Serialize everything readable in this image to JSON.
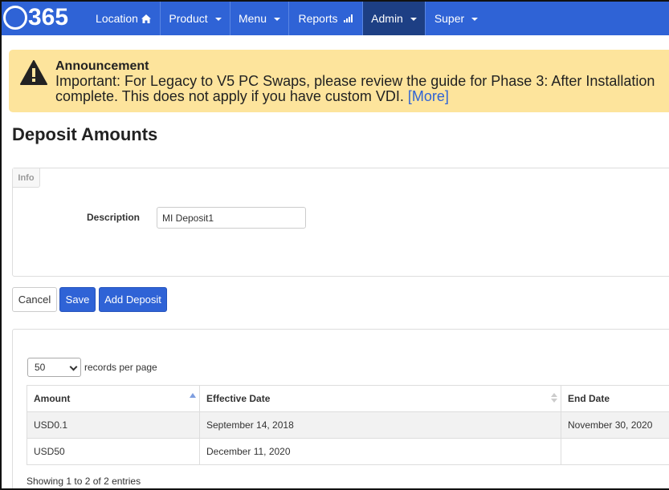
{
  "nav": {
    "logo_text": "365",
    "items": [
      {
        "label": "Location",
        "icon": "home-icon",
        "active": false,
        "caret": false
      },
      {
        "label": "Product",
        "active": false,
        "caret": true
      },
      {
        "label": "Menu",
        "active": false,
        "caret": true
      },
      {
        "label": "Reports",
        "icon": "signal-icon",
        "active": false,
        "caret": false
      },
      {
        "label": "Admin",
        "active": true,
        "caret": true
      },
      {
        "label": "Super",
        "active": false,
        "caret": true
      }
    ]
  },
  "announcement": {
    "title": "Announcement",
    "line1": "Important: For Legacy to V5 PC Swaps, please review the guide for Phase 3: After Installation",
    "line2": "complete. This does not apply if you have custom VDI.",
    "more_link": "[More]",
    "icon": "warning-icon",
    "background": "#fde49c"
  },
  "page": {
    "title": "Deposit Amounts"
  },
  "info": {
    "tab_label": "Info",
    "description_label": "Description",
    "description_value": "MI Deposit1"
  },
  "buttons": {
    "cancel": "Cancel",
    "save": "Save",
    "add_deposit": "Add Deposit"
  },
  "table": {
    "page_length": "50",
    "page_length_label": "records per page",
    "columns": [
      "Amount",
      "Effective Date",
      "End Date"
    ],
    "rows": [
      [
        "USD0.1",
        "September 14, 2018",
        "November 30, 2020"
      ],
      [
        "USD50",
        "December 11, 2020",
        ""
      ]
    ],
    "info": "Showing 1 to 2 of 2 entries"
  },
  "colors": {
    "primary": "#2f63d6",
    "nav_active": "#1d3f84",
    "announcement": "#fde49c"
  }
}
